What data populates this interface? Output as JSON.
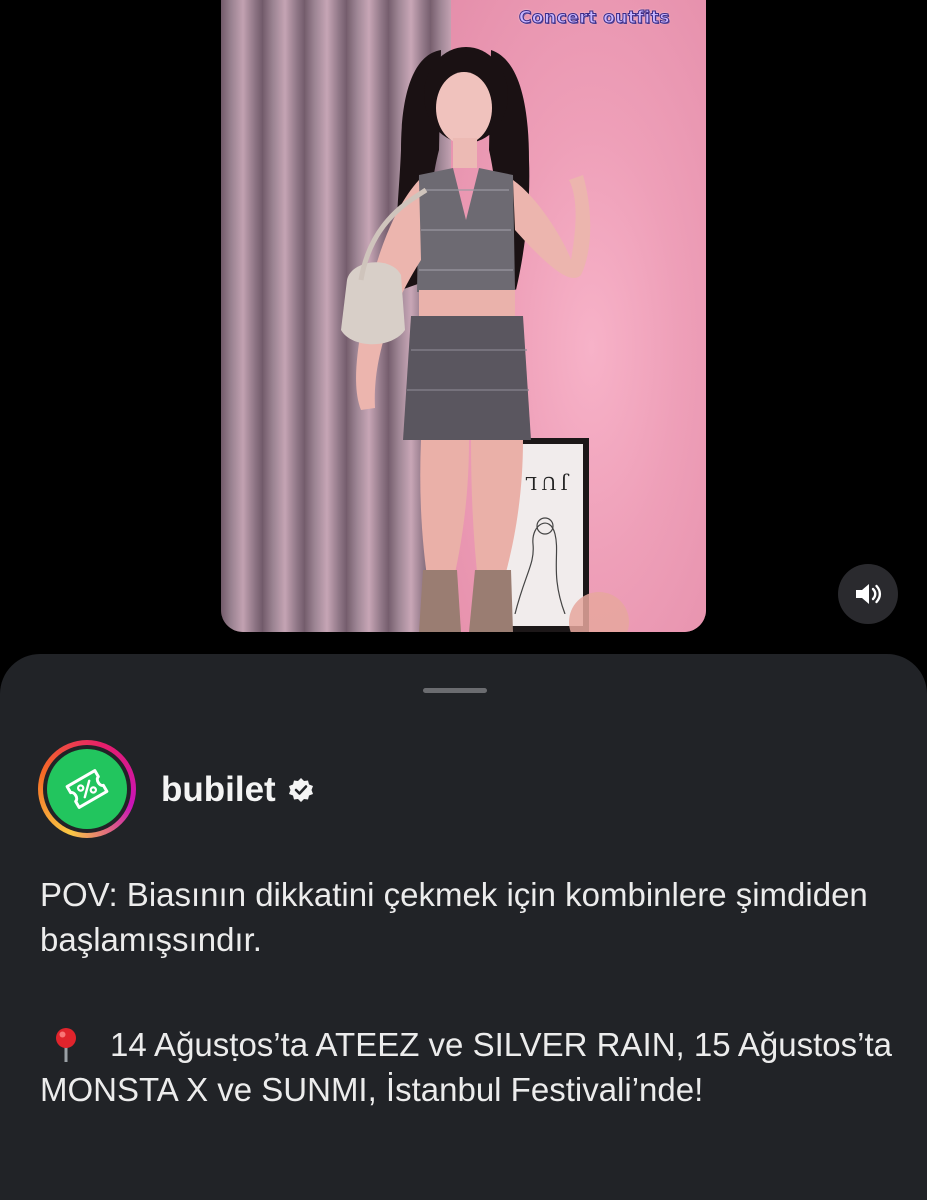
{
  "video": {
    "overlay_sticker": "Concert outfits",
    "poster_text": "JULI",
    "mute_icon": "speaker-icon"
  },
  "post": {
    "username": "bubilet",
    "verified_icon": "verified-badge-icon",
    "avatar_icon": "ticket-percent-icon",
    "avatar_color": "#22c55e",
    "caption_line1": "POV: Biasının dikkatini çekmek için kombinlere şimdiden başlamışsındır.",
    "caption_line2_icon": "pin-icon",
    "caption_line2": "14 Ağusṭos’ta ATEEZ ve SILVER RAIN, 15 Ağustos’ta MONSTA X ve SUNMI, İstanbul Festivali’nde!"
  },
  "colors": {
    "sheet_background": "#212327",
    "page_background": "#000000",
    "sticker_text": "#c7b6ff"
  }
}
